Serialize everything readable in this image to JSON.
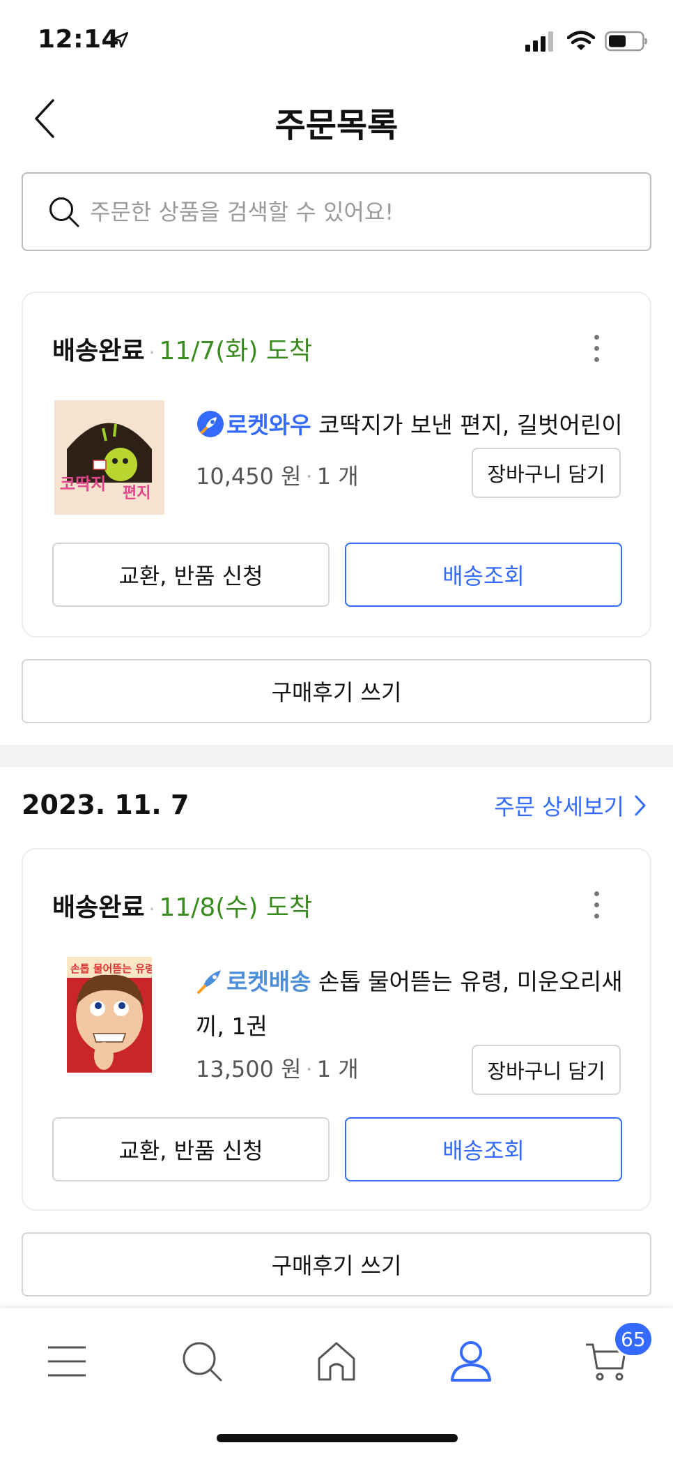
{
  "status_bar": {
    "time": "12:14"
  },
  "header": {
    "title": "주문목록"
  },
  "search": {
    "placeholder": "주문한 상품을 검색할 수 있어요!"
  },
  "orders": [
    {
      "status": "배송완료",
      "arrival": "11/7(화) 도착",
      "rocket_tag": "로켓와우",
      "rocket_color": "#346aff",
      "product_name": "코딱지가 보낸 편지, 길벗어린이",
      "price": "10,450 원",
      "quantity": "1 개",
      "cart_button": "장바구니 담기",
      "return_button": "교환, 반품 신청",
      "track_button": "배송조회",
      "review_button": "구매후기 쓰기"
    },
    {
      "order_date": "2023. 11. 7",
      "detail_link": "주문 상세보기",
      "status": "배송완료",
      "arrival": "11/8(수) 도착",
      "rocket_tag": "로켓배송",
      "rocket_color": "#4c8ed9",
      "product_name": "손톱 물어뜯는 유령, 미운오리새끼, 1권",
      "price": "13,500 원",
      "quantity": "1 개",
      "cart_button": "장바구니 담기",
      "return_button": "교환, 반품 신청",
      "track_button": "배송조회",
      "review_button": "구매후기 쓰기"
    }
  ],
  "tab_bar": {
    "tabs": [
      "menu-icon",
      "search-icon",
      "home-icon",
      "my-account-icon",
      "cart-icon"
    ],
    "active_tab": "my-account-icon",
    "cart_badge": "65"
  },
  "colors": {
    "accent": "#346aff",
    "arrival_green": "#3a8b1f"
  },
  "thumbnails": {
    "book1_title": "코딱지가 보낸 편지",
    "book2_title": "손톱 물어뜯는 유령"
  }
}
